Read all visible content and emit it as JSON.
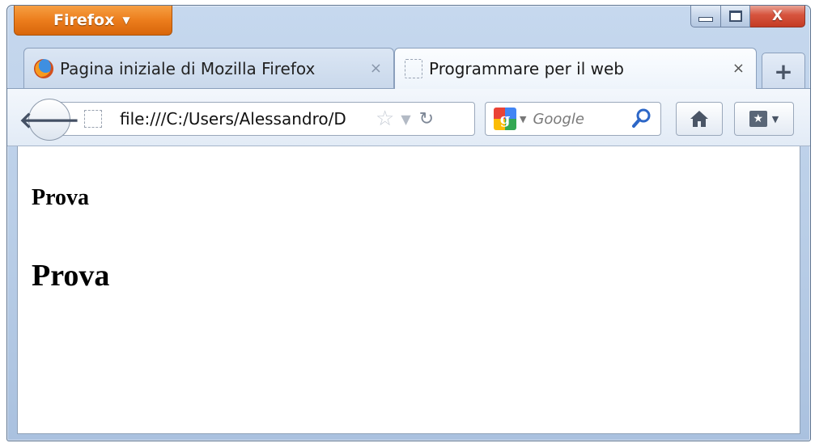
{
  "app": {
    "menu_button_label": "Firefox",
    "close_glyph": "X"
  },
  "tabs": [
    {
      "label": "Pagina iniziale di Mozilla Firefox",
      "close": "×",
      "icon": "firefox-logo-icon",
      "active": false
    },
    {
      "label": "Programmare per il web",
      "close": "×",
      "icon": "blank-page-icon",
      "active": true
    }
  ],
  "new_tab_label": "+",
  "navbar": {
    "url": "file:///C:/Users/Alessandro/D",
    "search_placeholder": "Google"
  },
  "content": {
    "heading_small": "Prova",
    "heading_large": "Prova"
  }
}
